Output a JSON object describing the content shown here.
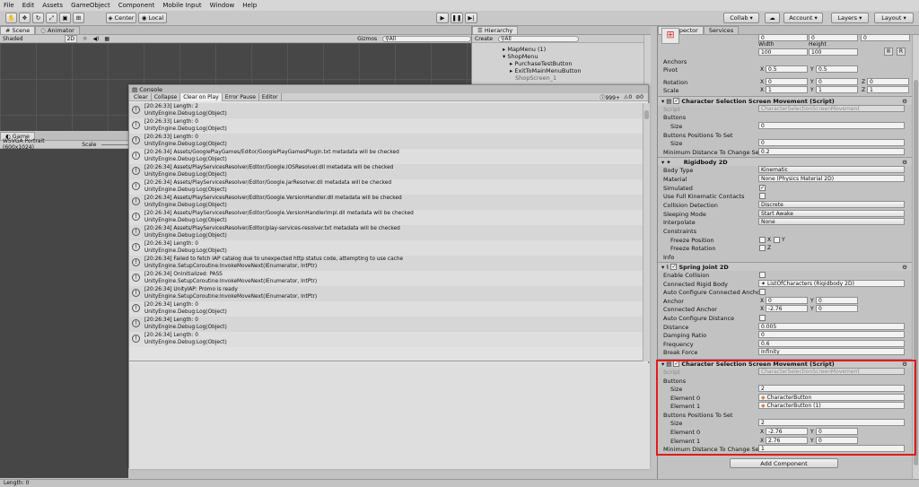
{
  "menu": [
    "File",
    "Edit",
    "Assets",
    "GameObject",
    "Component",
    "Mobile Input",
    "Window",
    "Help"
  ],
  "toolbar": {
    "center": "Center",
    "local": "Local",
    "collab": "Collab",
    "account": "Account",
    "layers": "Layers",
    "layout": "Layout"
  },
  "scene": {
    "tab": "Scene",
    "tab2": "Animator",
    "shading": "Shaded",
    "mode": "2D",
    "gizmos": "Gizmos",
    "search": "All"
  },
  "game": {
    "tab": "Game",
    "resolution": "WSVGA Portrait (600x1024)",
    "scale": "Scale"
  },
  "hierarchy": {
    "tab": "Hierarchy",
    "create": "Create",
    "search": "All",
    "items": [
      "MapMenu (1)",
      "ShopMenu",
      "PurchaseTestButton",
      "ExitToMainMenuButton",
      "ShopScreen_1"
    ]
  },
  "console": {
    "tab": "Console",
    "clear": "Clear",
    "collapse": "Collapse",
    "clear_on_play": "Clear on Play",
    "error_pause": "Error Pause",
    "editor": "Editor",
    "count": "999+",
    "warn_count": "0",
    "err_count": "0",
    "entries": [
      [
        "[20:26:33] Length: 2",
        "UnityEngine.Debug:Log(Object)"
      ],
      [
        "[20:26:33] Length: 0",
        "UnityEngine.Debug:Log(Object)"
      ],
      [
        "[20:26:33] Length: 0",
        "UnityEngine.Debug:Log(Object)"
      ],
      [
        "[20:26:34] Assets/GooglePlayGames/Editor/GooglePlayGamesPlugin.txt metadata will be checked",
        "UnityEngine.Debug:Log(Object)"
      ],
      [
        "[20:26:34] Assets/PlayServicesResolver/Editor/Google.IOSResolver.dll metadata will be checked",
        "UnityEngine.Debug:Log(Object)"
      ],
      [
        "[20:26:34] Assets/PlayServicesResolver/Editor/Google.JarResolver.dll metadata will be checked",
        "UnityEngine.Debug:Log(Object)"
      ],
      [
        "[20:26:34] Assets/PlayServicesResolver/Editor/Google.VersionHandler.dll metadata will be checked",
        "UnityEngine.Debug:Log(Object)"
      ],
      [
        "[20:26:34] Assets/PlayServicesResolver/Editor/Google.VersionHandlerImpl.dll metadata will be checked",
        "UnityEngine.Debug:Log(Object)"
      ],
      [
        "[20:26:34] Assets/PlayServicesResolver/Editor/play-services-resolver.txt metadata will be checked",
        "UnityEngine.Debug:Log(Object)"
      ],
      [
        "[20:26:34] Length: 0",
        "UnityEngine.Debug:Log(Object)"
      ],
      [
        "[20:26:34] Failed to fetch IAP catalog due to unexpected http status code, attempting to use cache",
        "UnityEngine.SetupCoroutine:InvokeMoveNext(IEnumerator, IntPtr)"
      ],
      [
        "[20:26:34] OnInitialized: PASS",
        "UnityEngine.SetupCoroutine:InvokeMoveNext(IEnumerator, IntPtr)"
      ],
      [
        "[20:26:34] UnityIAP: Promo is ready",
        "UnityEngine.SetupCoroutine:InvokeMoveNext(IEnumerator, IntPtr)"
      ],
      [
        "[20:26:34] Length: 0",
        "UnityEngine.Debug:Log(Object)"
      ],
      [
        "[20:26:34] Length: 0",
        "UnityEngine.Debug:Log(Object)"
      ],
      [
        "[20:26:34] Length: 0",
        "UnityEngine.Debug:Log(Object)"
      ]
    ]
  },
  "inspector": {
    "tab": "Inspector",
    "tab2": "Services",
    "rect": {
      "width_label": "Width",
      "height_label": "Height",
      "width": "100",
      "height": "100",
      "r": "R",
      "top0": "0",
      "top1": "0",
      "top2": "0"
    },
    "anchors": "Anchors",
    "pivot": "Pivot",
    "pivot_x": "0.5",
    "pivot_y": "0.5",
    "rotation": "Rotation",
    "rot_x": "0",
    "rot_y": "0",
    "rot_z": "0",
    "scale": "Scale",
    "scale_x": "1",
    "scale_y": "1",
    "scale_z": "1",
    "cssm1": {
      "title": "Character Selection Screen Movement (Script)",
      "script_label": "Script",
      "script": "CharacterSelectionScreenMovement",
      "buttons": "Buttons",
      "size_label": "Size",
      "size": "0",
      "bpos": "Buttons Positions To Set",
      "bpos_size": "0",
      "mindist_label": "Minimum Distance To Change Sele",
      "mindist": "0.2"
    },
    "rb": {
      "title": "Rigidbody 2D",
      "body_type_label": "Body Type",
      "body_type": "Kinematic",
      "material_label": "Material",
      "material": "None (Physics Material 2D)",
      "simulated": "Simulated",
      "full_kin": "Use Full Kinematic Contacts",
      "coll_label": "Collision Detection",
      "coll": "Discrete",
      "sleep_label": "Sleeping Mode",
      "sleep": "Start Awake",
      "interp_label": "Interpolate",
      "interp": "None",
      "constraints": "Constraints",
      "freeze_pos": "Freeze Position",
      "freeze_rot": "Freeze Rotation",
      "x": "X",
      "y": "Y",
      "z": "Z",
      "info": "Info"
    },
    "sj": {
      "title": "Spring Joint 2D",
      "enable_coll": "Enable Collision",
      "conn_rb_label": "Connected Rigid Body",
      "conn_rb": "ListOfCharacters (Rigidbody 2D)",
      "auto_conn": "Auto Configure Connected Anchor",
      "anchor": "Anchor",
      "anchor_x": "0",
      "anchor_y": "0",
      "conn_anchor": "Connected Anchor",
      "conn_x": "-2.76",
      "conn_y": "0",
      "auto_dist": "Auto Configure Distance",
      "dist_label": "Distance",
      "dist": "0.005",
      "damp_label": "Damping Ratio",
      "damp": "0",
      "freq_label": "Frequency",
      "freq": "0.6",
      "break_label": "Break Force",
      "break": "Infinity"
    },
    "cssm2": {
      "title": "Character Selection Screen Movement (Script)",
      "script_label": "Script",
      "script": "CharacterSelectionScreenMovement",
      "buttons": "Buttons",
      "size_label": "Size",
      "size": "2",
      "el0_label": "Element 0",
      "el0": "CharacterButton",
      "el1_label": "Element 1",
      "el1": "CharacterButton (1)",
      "bpos": "Buttons Positions To Set",
      "bpos_size": "2",
      "e0x": "-2.76",
      "e0y": "0",
      "e1x": "2.76",
      "e1y": "0",
      "mindist_label": "Minimum Distance To Change Sele",
      "mindist": "1"
    },
    "add_component": "Add Component"
  },
  "status": {
    "text": "Length: 0"
  },
  "colors": {
    "highlight": "#e01c1c"
  }
}
